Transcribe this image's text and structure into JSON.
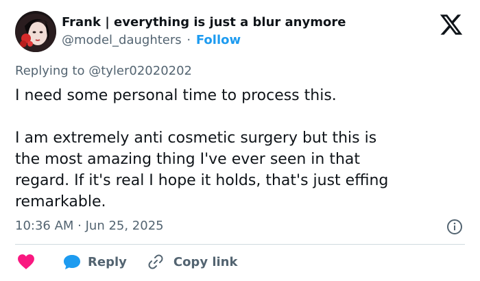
{
  "author": {
    "display_name": "Frank | everything is just a blur anymore",
    "handle": "@model_daughters",
    "separator": "·",
    "follow_label": "Follow"
  },
  "replying_to": "Replying to @tyler02020202",
  "tweet": {
    "paragraph1_line1": "I need some personal time to process this.",
    "paragraph2_line1": "I am extremely anti cosmetic surgery but this is",
    "paragraph2_line2": "the most amazing thing I've ever seen in that",
    "paragraph2_line3": "regard. If it's real I hope it holds, that's just effing",
    "paragraph2_line4": "remarkable."
  },
  "timestamp": "10:36 AM · Jun 25, 2025",
  "actions": {
    "reply_label": "Reply",
    "copy_link_label": "Copy link"
  },
  "icons": {
    "brand": "x-logo-icon",
    "info": "info-icon",
    "like": "heart-icon",
    "reply": "reply-bubble-icon",
    "copy": "link-icon"
  },
  "colors": {
    "accent": "#1d9bf0",
    "heart": "#f91880",
    "secondary_text": "#536471",
    "primary_text": "#0f1419",
    "divider": "#cfd9de"
  }
}
